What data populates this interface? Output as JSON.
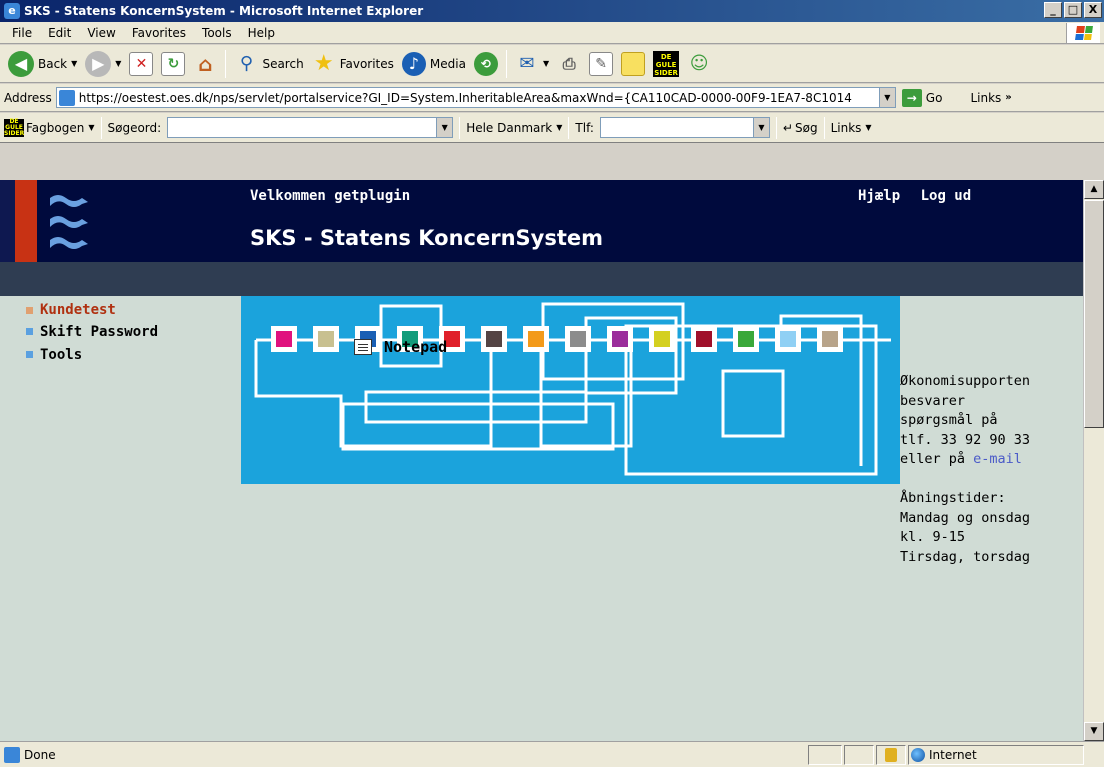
{
  "window": {
    "title": "SKS - Statens KoncernSystem - Microsoft Internet Explorer",
    "controls": [
      "_",
      "□",
      "X"
    ]
  },
  "menu": [
    "File",
    "Edit",
    "View",
    "Favorites",
    "Tools",
    "Help"
  ],
  "toolbar": {
    "back": "Back",
    "search": "Search",
    "favorites": "Favorites",
    "media": "Media",
    "gule_sider": "DE GULE SIDER"
  },
  "address": {
    "label": "Address",
    "url": "https://oestest.oes.dk/nps/servlet/portalservice?GI_ID=System.InheritableArea&maxWnd={CA110CAD-0000-00F9-1EA7-8C1014",
    "go": "Go",
    "links": "Links"
  },
  "fagbar": {
    "fagbogen": "Fagbogen",
    "sogeord_label": "Søgeord:",
    "sogeord_value": "",
    "region": "Hele Danmark",
    "tlf_label": "Tlf:",
    "tlf_value": "",
    "sog": "Søg",
    "links": "Links"
  },
  "header": {
    "welcome": "Velkommen  getplugin",
    "title": "SKS - Statens KoncernSystem",
    "help": "Hjælp",
    "logout": "Log ud"
  },
  "nav": {
    "items": [
      {
        "label": "Kundetest",
        "color": "#b03010",
        "bullet": "#e0a070"
      },
      {
        "label": "Skift Password",
        "color": "#000000",
        "bullet": "#5aa0e0"
      },
      {
        "label": "Tools",
        "color": "#000000",
        "bullet": "#5aa0e0"
      }
    ]
  },
  "banner": {
    "square_colors": [
      "#e0127e",
      "#c8c090",
      "#1a5fb4",
      "#139c7a",
      "#e0202a",
      "#544444",
      "#f39a1a",
      "#8c8c8c",
      "#9b2d9b",
      "#d4d020",
      "#a0102a",
      "#3aa83a",
      "#90d0f4",
      "#b8a48a"
    ]
  },
  "notepad": {
    "label": "Notepad"
  },
  "support": {
    "lines": [
      "Økonomisupporten",
      "besvarer",
      "spørgsmål på",
      "tlf. 33 92 90 33"
    ],
    "email_prefix": "eller på ",
    "email_link": "e-mail",
    "hours": [
      "Åbningstider:",
      "Mandag og onsdag",
      "kl. 9-15",
      "Tirsdag, torsdag"
    ]
  },
  "status": {
    "text": "Done",
    "zone": "Internet"
  }
}
